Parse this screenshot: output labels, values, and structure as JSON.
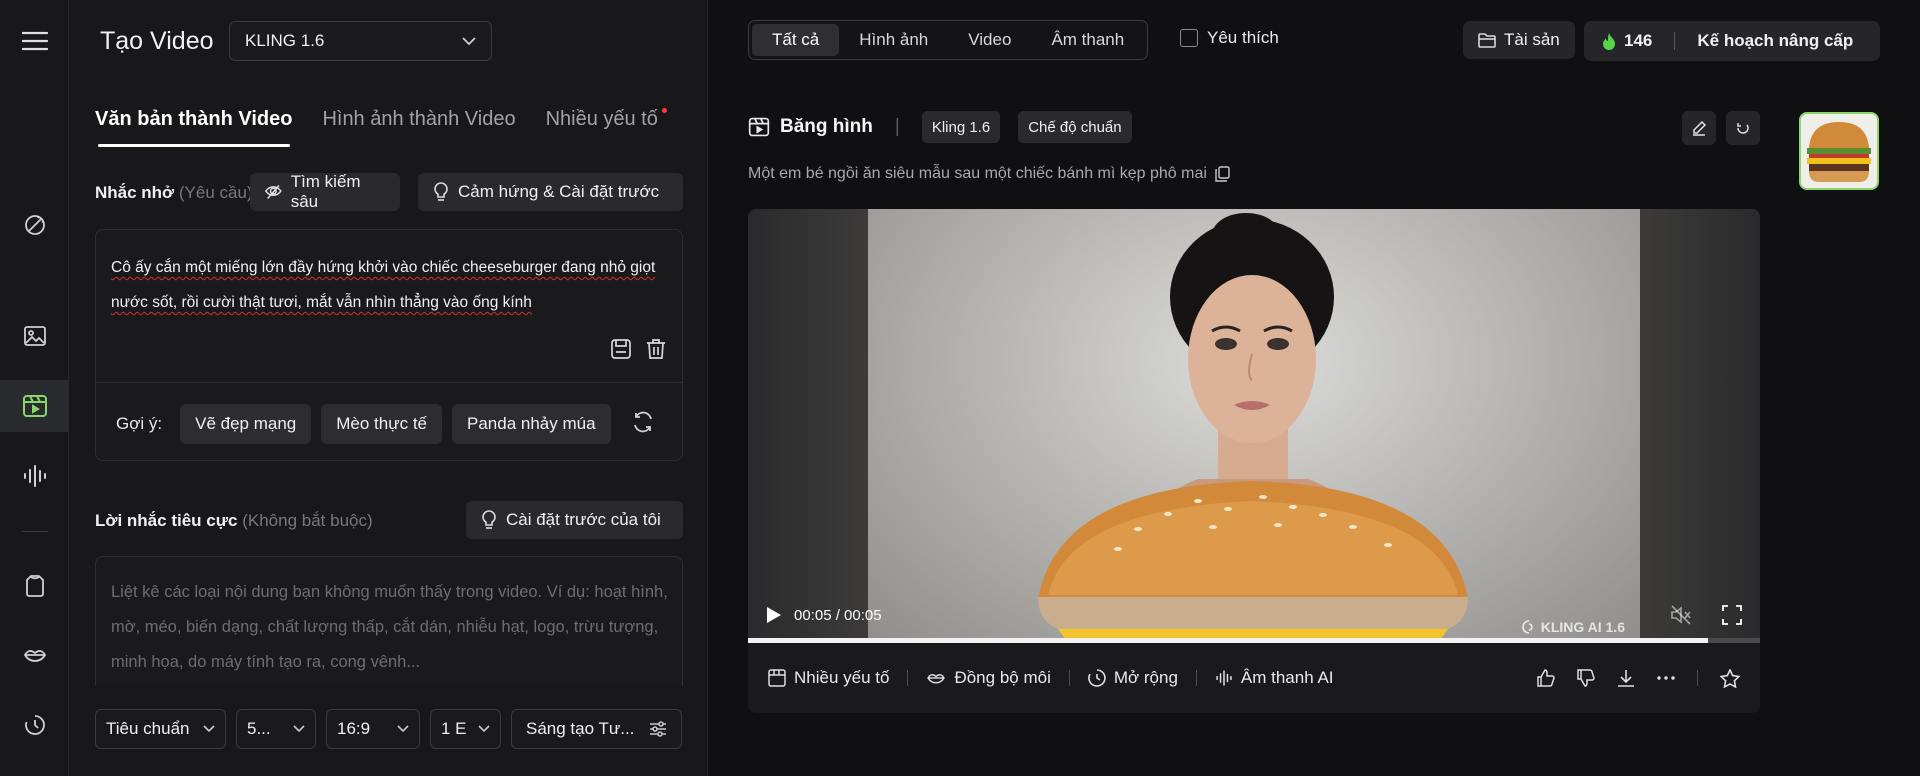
{
  "left_panel": {
    "title": "Tạo Video",
    "model_select": "KLING 1.6",
    "tabs": [
      {
        "label": "Văn bản thành Video",
        "active": true
      },
      {
        "label": "Hình ảnh thành Video",
        "active": false
      },
      {
        "label": "Nhiều yếu tố",
        "active": false,
        "has_dot": true
      }
    ],
    "prompt": {
      "label": "Nhắc nhở",
      "hint": "(Yêu cầu)",
      "deep_search_label": "Tìm kiếm sâu",
      "inspiration_label": "Cảm hứng & Cài đặt trước",
      "text": "Cô ấy cắn một miếng lớn đầy hứng khởi vào chiếc cheeseburger đang nhỏ giọt nước sốt, rồi cười thật tươi, mắt vẫn nhìn thẳng vào ống kính",
      "suggest_label": "Gợi ý:",
      "suggestions": [
        "Vẽ đẹp mạng",
        "Mèo thực tế",
        "Panda nhảy múa"
      ]
    },
    "negative": {
      "label": "Lời nhắc tiêu cực",
      "hint": "(Không bắt buộc)",
      "preset_label": "Cài đặt trước của tôi",
      "placeholder": "Liệt kê các loại nội dung bạn không muốn thấy trong video. Ví dụ: hoạt hình, mờ, méo, biến dạng, chất lượng thấp, cắt dán, nhiễu hạt, logo, trừu tượng, minh họa, do máy tính tạo ra, cong vênh..."
    },
    "bottom": {
      "quality": "Tiêu chuẩn",
      "duration": "5...",
      "ratio": "16:9",
      "count": "1 E",
      "creative": "Sáng tạo Tư..."
    }
  },
  "header": {
    "filters": [
      {
        "label": "Tất cả",
        "active": true
      },
      {
        "label": "Hình ảnh",
        "active": false
      },
      {
        "label": "Video",
        "active": false
      },
      {
        "label": "Âm thanh",
        "active": false
      }
    ],
    "favorite_label": "Yêu thích",
    "assets_label": "Tài sản",
    "credits": "146",
    "upgrade_label": "Kế hoạch nâng cấp"
  },
  "card": {
    "type_label": "Băng hình",
    "model_tag": "Kling 1.6",
    "mode_tag": "Chế độ chuẩn",
    "caption": "Một em bé ngồi ăn siêu mẫu sau một chiếc bánh mì kẹp phô mai",
    "video": {
      "time": "00:05 / 00:05",
      "watermark": "KLING AI 1.6",
      "progress": 0.949
    },
    "actions": [
      "Nhiều yếu tố",
      "Đồng bộ môi",
      "Mở rộng",
      "Âm thanh AI"
    ]
  },
  "colors": {
    "accent_green": "#8bd66a",
    "flame": "#55d64a",
    "error_underline": "#d32f2f"
  }
}
